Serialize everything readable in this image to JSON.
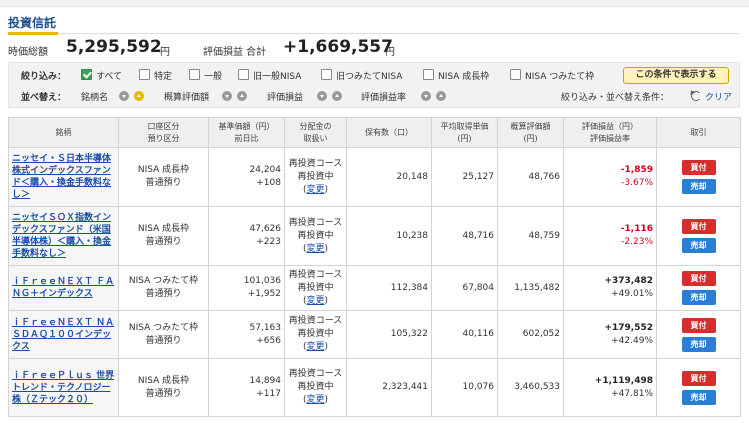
{
  "page": {
    "title": "投資信託"
  },
  "summary": {
    "market_value_label": "時価総額",
    "market_value": "5,295,592",
    "market_value_unit": "円",
    "pl_label": "評価損益 合計",
    "pl_value": "+1,669,557",
    "pl_unit": "円"
  },
  "filter": {
    "label": "絞り込み：",
    "options": [
      {
        "label": "すべて",
        "checked": true
      },
      {
        "label": "特定",
        "checked": false
      },
      {
        "label": "一般",
        "checked": false
      },
      {
        "label": "旧一般NISA",
        "checked": false
      },
      {
        "label": "旧つみたてNISA",
        "checked": false
      },
      {
        "label": "NISA 成長枠",
        "checked": false
      },
      {
        "label": "NISA つみたて枠",
        "checked": false
      }
    ],
    "apply_button": "この条件で表示する"
  },
  "sort": {
    "label": "並べ替え：",
    "keys": [
      "銘柄名",
      "概算評価額",
      "評価損益",
      "評価損益率"
    ],
    "condition_label": "絞り込み・並べ替え条件：",
    "clear_label": "クリア"
  },
  "table": {
    "headers": [
      {
        "l1": "銘柄",
        "l2": ""
      },
      {
        "l1": "口座区分",
        "l2": "預り区分"
      },
      {
        "l1": "基準価額（円）",
        "l2": "前日比"
      },
      {
        "l1": "分配金の",
        "l2": "取扱い"
      },
      {
        "l1": "保有数（口）",
        "l2": ""
      },
      {
        "l1": "平均取得単価",
        "l2": "(円)"
      },
      {
        "l1": "概算評価額",
        "l2": "(円)"
      },
      {
        "l1": "評価損益（円）",
        "l2": "評価損益率"
      },
      {
        "l1": "取引",
        "l2": ""
      }
    ],
    "rows": [
      {
        "name": "ニッセイ・Ｓ日本半導体株式インデックスファンド＜購入・換金手数料なし＞",
        "account": "NISA 成長枠",
        "deposit": "普通預り",
        "nav": "24,204",
        "nav_change": "+108",
        "dist1": "再投資コース",
        "dist2": "再投資中",
        "dist_change": "変更",
        "units": "20,148",
        "avg_cost": "25,127",
        "value": "48,766",
        "pl": "-1,859",
        "pl_rate": "-3.67%",
        "pl_sign": "neg",
        "buy": "買付",
        "sell": "売却"
      },
      {
        "name": "ニッセイＳＯＸ指数インデックスファンド（米国半導体株）＜購入・換金手数料なし＞",
        "account": "NISA 成長枠",
        "deposit": "普通預り",
        "nav": "47,626",
        "nav_change": "+223",
        "dist1": "再投資コース",
        "dist2": "再投資中",
        "dist_change": "変更",
        "units": "10,238",
        "avg_cost": "48,716",
        "value": "48,759",
        "pl": "-1,116",
        "pl_rate": "-2.23%",
        "pl_sign": "neg",
        "buy": "買付",
        "sell": "売却"
      },
      {
        "name": "ｉＦｒｅｅＮＥＸＴ ＦＡＮＧ＋インデックス",
        "account": "NISA つみたて枠",
        "deposit": "普通預り",
        "nav": "101,036",
        "nav_change": "+1,952",
        "dist1": "再投資コース",
        "dist2": "再投資中",
        "dist_change": "変更",
        "units": "112,384",
        "avg_cost": "67,804",
        "value": "1,135,482",
        "pl": "+373,482",
        "pl_rate": "+49.01%",
        "pl_sign": "pos",
        "buy": "買付",
        "sell": "売却"
      },
      {
        "name": "ｉＦｒｅｅＮＥＸＴ ＮＡＳＤＡＱ１００インデックス",
        "account": "NISA つみたて枠",
        "deposit": "普通預り",
        "nav": "57,163",
        "nav_change": "+656",
        "dist1": "再投資コース",
        "dist2": "再投資中",
        "dist_change": "変更",
        "units": "105,322",
        "avg_cost": "40,116",
        "value": "602,052",
        "pl": "+179,552",
        "pl_rate": "+42.49%",
        "pl_sign": "pos",
        "buy": "買付",
        "sell": "売却"
      },
      {
        "name": "ｉＦｒｅｅＰｌｕｓ 世界トレンド・テクノロジー株（Ｚテック２０）",
        "account": "NISA 成長枠",
        "deposit": "普通預り",
        "nav": "14,894",
        "nav_change": "+117",
        "dist1": "再投資コース",
        "dist2": "再投資中",
        "dist_change": "変更",
        "units": "2,323,441",
        "avg_cost": "10,076",
        "value": "3,460,533",
        "pl": "+1,119,498",
        "pl_rate": "+47.81%",
        "pl_sign": "pos",
        "buy": "買付",
        "sell": "売却"
      }
    ]
  },
  "colors": {
    "accent": "#e8b800",
    "title": "#1f4e8c",
    "buy": "#d62d2d",
    "sell": "#2a7fd4",
    "negative": "#d8001f"
  }
}
